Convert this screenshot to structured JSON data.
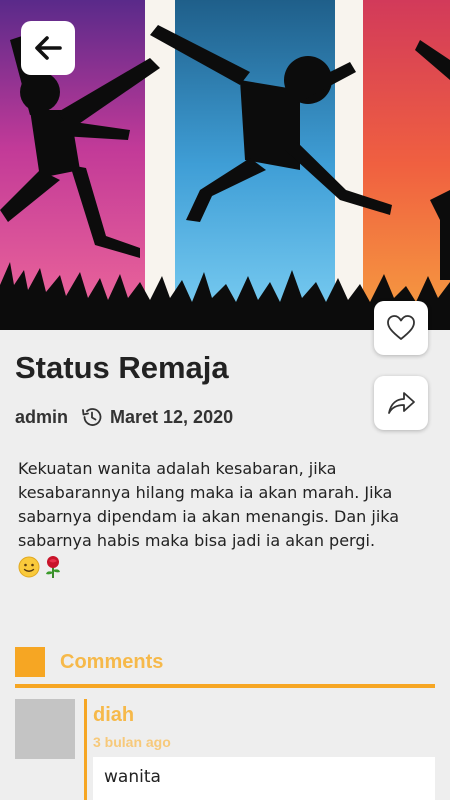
{
  "header": {
    "back_icon": "arrow-left-icon",
    "like_icon": "heart-outline-icon",
    "share_icon": "share-arrow-icon"
  },
  "post": {
    "title": "Status Remaja",
    "author": "admin",
    "date": "Maret 12, 2020",
    "date_icon": "history-clock-icon",
    "body": "Kekuatan wanita adalah kesabaran, jika kesabarannya hilang maka ia akan marah. Jika sabarnya dipendam ia akan menangis. Dan jika sabarnya habis maka bisa jadi ia akan pergi.",
    "emojis": [
      "slightly-smiling-face-emoji",
      "rose-emoji"
    ]
  },
  "comments": {
    "heading": "Comments",
    "accent_color": "#f6a623",
    "items": [
      {
        "name": "diah",
        "time": "3 bulan ago",
        "text": "wanita"
      }
    ]
  }
}
